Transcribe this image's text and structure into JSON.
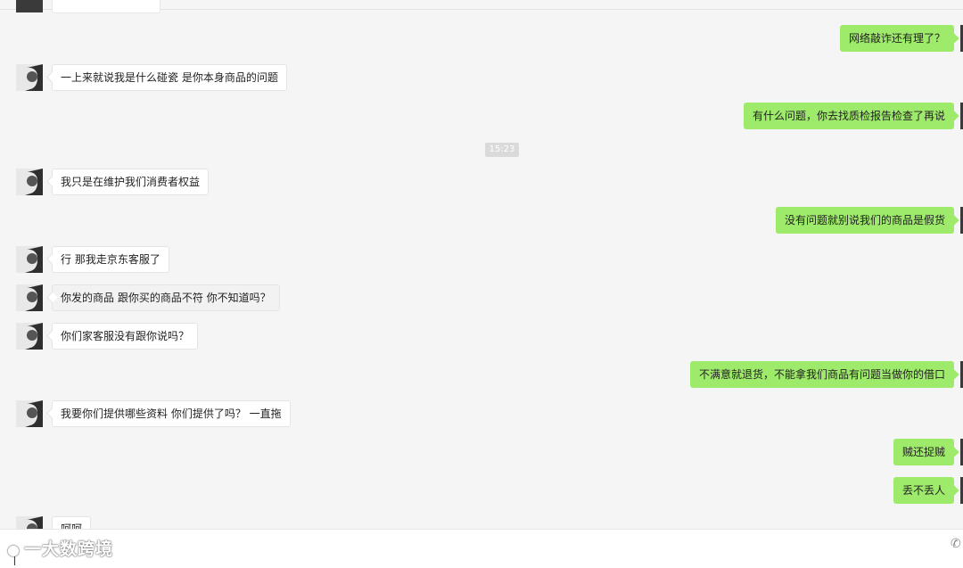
{
  "chat": {
    "timestamp": "15:23",
    "messages": [
      {
        "side": "out",
        "text": "网络敲诈还有理了？"
      },
      {
        "side": "in",
        "text": "一上来就说我是什么碰瓷 是你本身商品的问题"
      },
      {
        "side": "out",
        "text": "有什么问题，你去找质检报告检查了再说"
      },
      {
        "side": "in",
        "text": "我只是在维护我们消费者权益"
      },
      {
        "side": "out",
        "text": "没有问题就别说我们的商品是假货"
      },
      {
        "side": "in",
        "text": "行 那我走京东客服了"
      },
      {
        "side": "in",
        "text": "你发的商品 跟你买的商品不符 你不知道吗？"
      },
      {
        "side": "in",
        "text": "你们家客服没有跟你说吗？"
      },
      {
        "side": "out",
        "text": "不满意就退货，不能拿我们商品有问题当做你的借口"
      },
      {
        "side": "in",
        "text": "我要你们提供哪些资料 你们提供了吗？ 一直拖"
      },
      {
        "side": "out",
        "text": "贼还捉贼"
      },
      {
        "side": "out",
        "text": "丢不丢人"
      },
      {
        "side": "in",
        "text": "呵呵"
      }
    ]
  },
  "watermark": {
    "text": "一大数跨境"
  },
  "icons": {
    "phone": "phone-icon",
    "avatar": "avatar-icon"
  }
}
